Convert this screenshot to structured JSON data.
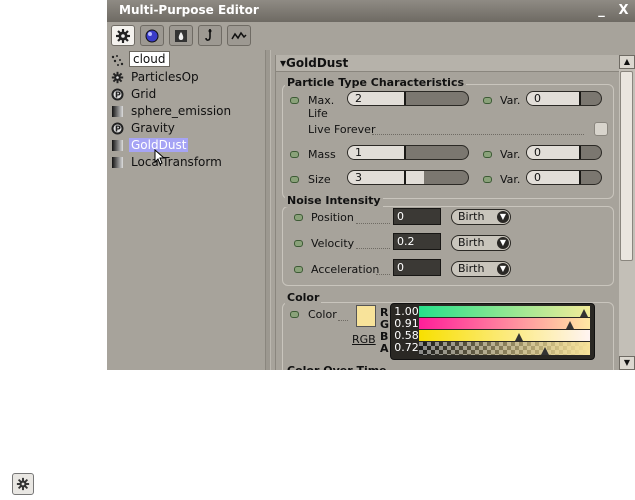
{
  "window": {
    "title": "Multi-Purpose Editor",
    "minimize_glyph": "_",
    "close_glyph": "X"
  },
  "tabs": [
    {
      "icon": "gear-icon",
      "active": true
    },
    {
      "icon": "sphere-icon",
      "active": false
    },
    {
      "icon": "flame-icon",
      "active": false
    },
    {
      "icon": "hook-icon",
      "active": false
    },
    {
      "icon": "curve-icon",
      "active": false
    }
  ],
  "tree": {
    "items": [
      {
        "label": "cloud",
        "icon": "particle-dots-icon",
        "state": "renaming"
      },
      {
        "label": "ParticlesOp",
        "icon": "gear-icon"
      },
      {
        "label": "Grid",
        "icon": "p-node-icon"
      },
      {
        "label": "sphere_emission",
        "icon": "gradient-node-icon"
      },
      {
        "label": "Gravity",
        "icon": "p-node-icon"
      },
      {
        "label": "GoldDust",
        "icon": "gradient-node-icon",
        "state": "selected"
      },
      {
        "label": "LocalTransform",
        "icon": "gradient-node-icon"
      }
    ]
  },
  "panel": {
    "title": "GoldDust",
    "particle": {
      "title": "Particle Type Characteristics",
      "max_life_label": "Max. Life",
      "max_life_value": "2",
      "max_life_var_label": "Var.",
      "max_life_var_value": "0",
      "live_forever_label": "Live Forever",
      "mass_label": "Mass",
      "mass_value": "1",
      "mass_var_label": "Var.",
      "mass_var_value": "0",
      "size_label": "Size",
      "size_value": "3",
      "size_var_label": "Var.",
      "size_var_value": "0"
    },
    "noise": {
      "title": "Noise Intensity",
      "position_label": "Position",
      "position_value": "0",
      "position_mode": "Birth",
      "velocity_label": "Velocity",
      "velocity_value": "0.2",
      "velocity_mode": "Birth",
      "acceleration_label": "Acceleration",
      "acceleration_value": "0",
      "acceleration_mode": "Birth"
    },
    "color": {
      "title": "Color",
      "color_label": "Color",
      "swatch": "#f8e39a",
      "mode_label": "RGB",
      "channels": [
        {
          "label": "R",
          "value": "1.000"
        },
        {
          "label": "G",
          "value": "0.913"
        },
        {
          "label": "B",
          "value": "0.583"
        },
        {
          "label": "A",
          "value": "0.728"
        }
      ],
      "next_section_partial": "Color Over Time"
    }
  },
  "colors": {
    "accent_selected": "#a6a4f5",
    "window_bg": "#a7a39b",
    "titlebar": "#7a766f"
  },
  "floating_icon": "gear-icon"
}
